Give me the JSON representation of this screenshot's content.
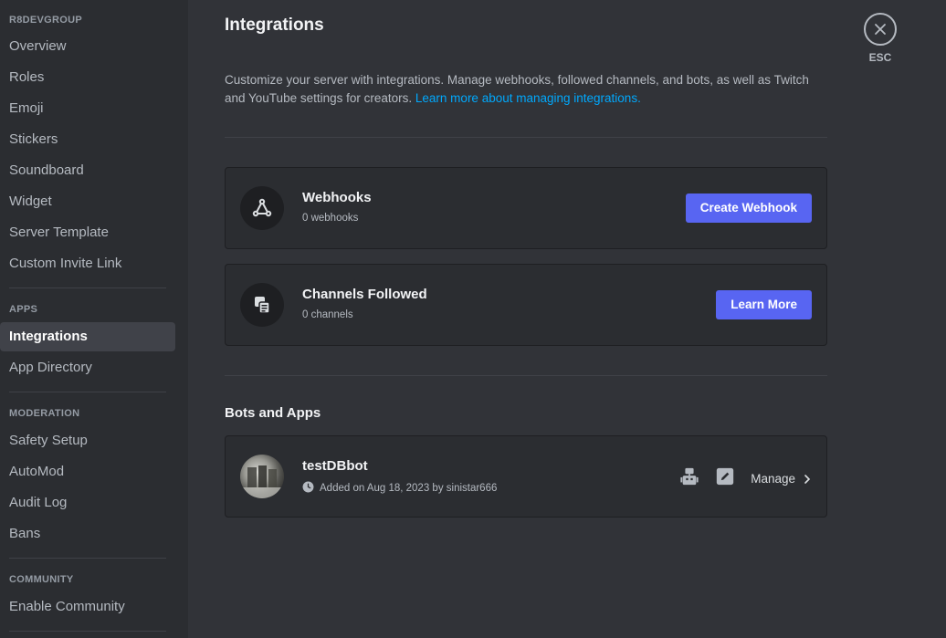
{
  "sidebar": {
    "server_heading": "R8DEVGROUP",
    "server_items": [
      "Overview",
      "Roles",
      "Emoji",
      "Stickers",
      "Soundboard",
      "Widget",
      "Server Template",
      "Custom Invite Link"
    ],
    "apps_heading": "APPS",
    "apps_items": [
      "Integrations",
      "App Directory"
    ],
    "moderation_heading": "MODERATION",
    "moderation_items": [
      "Safety Setup",
      "AutoMod",
      "Audit Log",
      "Bans"
    ],
    "community_heading": "COMMUNITY",
    "community_items": [
      "Enable Community"
    ],
    "active_item": "Integrations"
  },
  "main": {
    "title": "Integrations",
    "description": "Customize your server with integrations. Manage webhooks, followed channels, and bots, as well as Twitch and YouTube settings for creators.",
    "learn_more_link": "Learn more about managing integrations.",
    "webhooks": {
      "title": "Webhooks",
      "subtitle": "0 webhooks",
      "button": "Create Webhook"
    },
    "channels_followed": {
      "title": "Channels Followed",
      "subtitle": "0 channels",
      "button": "Learn More"
    },
    "bots_section_title": "Bots and Apps",
    "bot": {
      "name": "testDBbot",
      "added": "Added on Aug 18, 2023 by sinistar666",
      "manage_label": "Manage"
    }
  },
  "esc": {
    "label": "ESC"
  },
  "colors": {
    "accent": "#5865f2",
    "link": "#00a8fc",
    "sidebar_bg": "#2b2d31",
    "main_bg": "#313338"
  }
}
